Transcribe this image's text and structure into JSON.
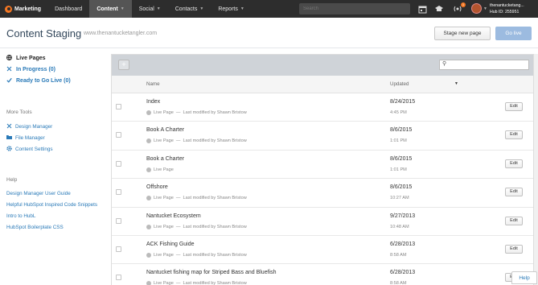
{
  "nav": {
    "brand": "Marketing",
    "items": [
      {
        "label": "Dashboard",
        "dropdown": false,
        "active": false
      },
      {
        "label": "Content",
        "dropdown": true,
        "active": true
      },
      {
        "label": "Social",
        "dropdown": true,
        "active": false
      },
      {
        "label": "Contacts",
        "dropdown": true,
        "active": false
      },
      {
        "label": "Reports",
        "dropdown": true,
        "active": false
      }
    ],
    "search_placeholder": "Search",
    "notification_count": "1",
    "account_name": "thenantucketang...",
    "hub_id": "Hub ID: 255951"
  },
  "header": {
    "title": "Content Staging",
    "domain": "www.thenantucketangler.com",
    "stage_button": "Stage new page",
    "golive_button": "Go live"
  },
  "sidebar": {
    "statuses": [
      {
        "label": "Live Pages",
        "icon": "globe-icon"
      },
      {
        "label": "In Progress (0)",
        "icon": "tools-icon"
      },
      {
        "label": "Ready to Go Live (0)",
        "icon": "check-icon"
      }
    ],
    "more_tools_heading": "More Tools",
    "tools": [
      {
        "label": "Design Manager",
        "icon": "design-icon"
      },
      {
        "label": "File Manager",
        "icon": "folder-icon"
      },
      {
        "label": "Content Settings",
        "icon": "gear-icon"
      }
    ],
    "help_heading": "Help",
    "help_links": [
      {
        "label": "Design Manager User Guide"
      },
      {
        "label": "Helpful HubSpot Inspired Code Snippets"
      },
      {
        "label": "Intro to HubL"
      },
      {
        "label": "HubSpot Boilerplate CSS"
      }
    ]
  },
  "table": {
    "col_name": "Name",
    "col_updated": "Updated",
    "edit_label": "Edit",
    "rows": [
      {
        "name": "Index",
        "status": "Live Page",
        "modified": "Last modified by Shawn Bristow",
        "date": "8/24/2015",
        "time": "4:45 PM"
      },
      {
        "name": "Book A Charter",
        "status": "Live Page",
        "modified": "Last modified by Shawn Bristow",
        "date": "8/6/2015",
        "time": "1:01 PM"
      },
      {
        "name": "Book a Charter",
        "status": "Live Page",
        "modified": "",
        "date": "8/6/2015",
        "time": "1:01 PM"
      },
      {
        "name": "Offshore",
        "status": "Live Page",
        "modified": "Last modified by Shawn Bristow",
        "date": "8/6/2015",
        "time": "10:27 AM"
      },
      {
        "name": "Nantucket Ecosystem",
        "status": "Live Page",
        "modified": "Last modified by Shawn Bristow",
        "date": "9/27/2013",
        "time": "10:48 AM"
      },
      {
        "name": "ACK Fishing Guide",
        "status": "Live Page",
        "modified": "Last modified by Shawn Bristow",
        "date": "6/28/2013",
        "time": "8:58 AM"
      },
      {
        "name": "Nantucket fishing map for Striped Bass and Bluefish",
        "status": "Live Page",
        "modified": "Last modified by Shawn Bristow",
        "date": "6/28/2013",
        "time": "8:58 AM"
      }
    ]
  },
  "help_tab": "Help"
}
